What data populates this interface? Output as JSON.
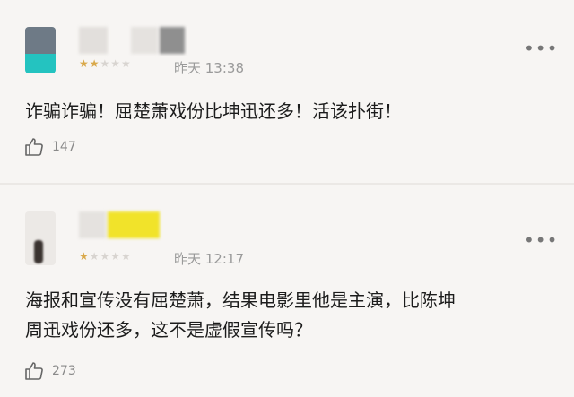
{
  "comments": [
    {
      "time": "昨天 13:38",
      "text_lines": [
        "诈骗诈骗！屈楚萧戏份比坤迅还多！活该扑街！"
      ],
      "likes": "147",
      "rating": {
        "filled": 2,
        "total": 5
      },
      "more_icon": "more-dots-icon",
      "like_icon": "thumbs-up-icon"
    },
    {
      "time": "昨天 12:17",
      "text_lines": [
        "海报和宣传没有屈楚萧，结果电影里他是主演，比陈坤",
        "周迅戏份还多，这不是虚假宣传吗？"
      ],
      "likes": "273",
      "rating": {
        "filled": 1,
        "total": 5
      },
      "more_icon": "more-dots-icon",
      "like_icon": "thumbs-up-icon"
    }
  ],
  "colors": {
    "background": "#f7f5f3",
    "star": "#d9a94b",
    "muted": "#9a9a9a"
  }
}
